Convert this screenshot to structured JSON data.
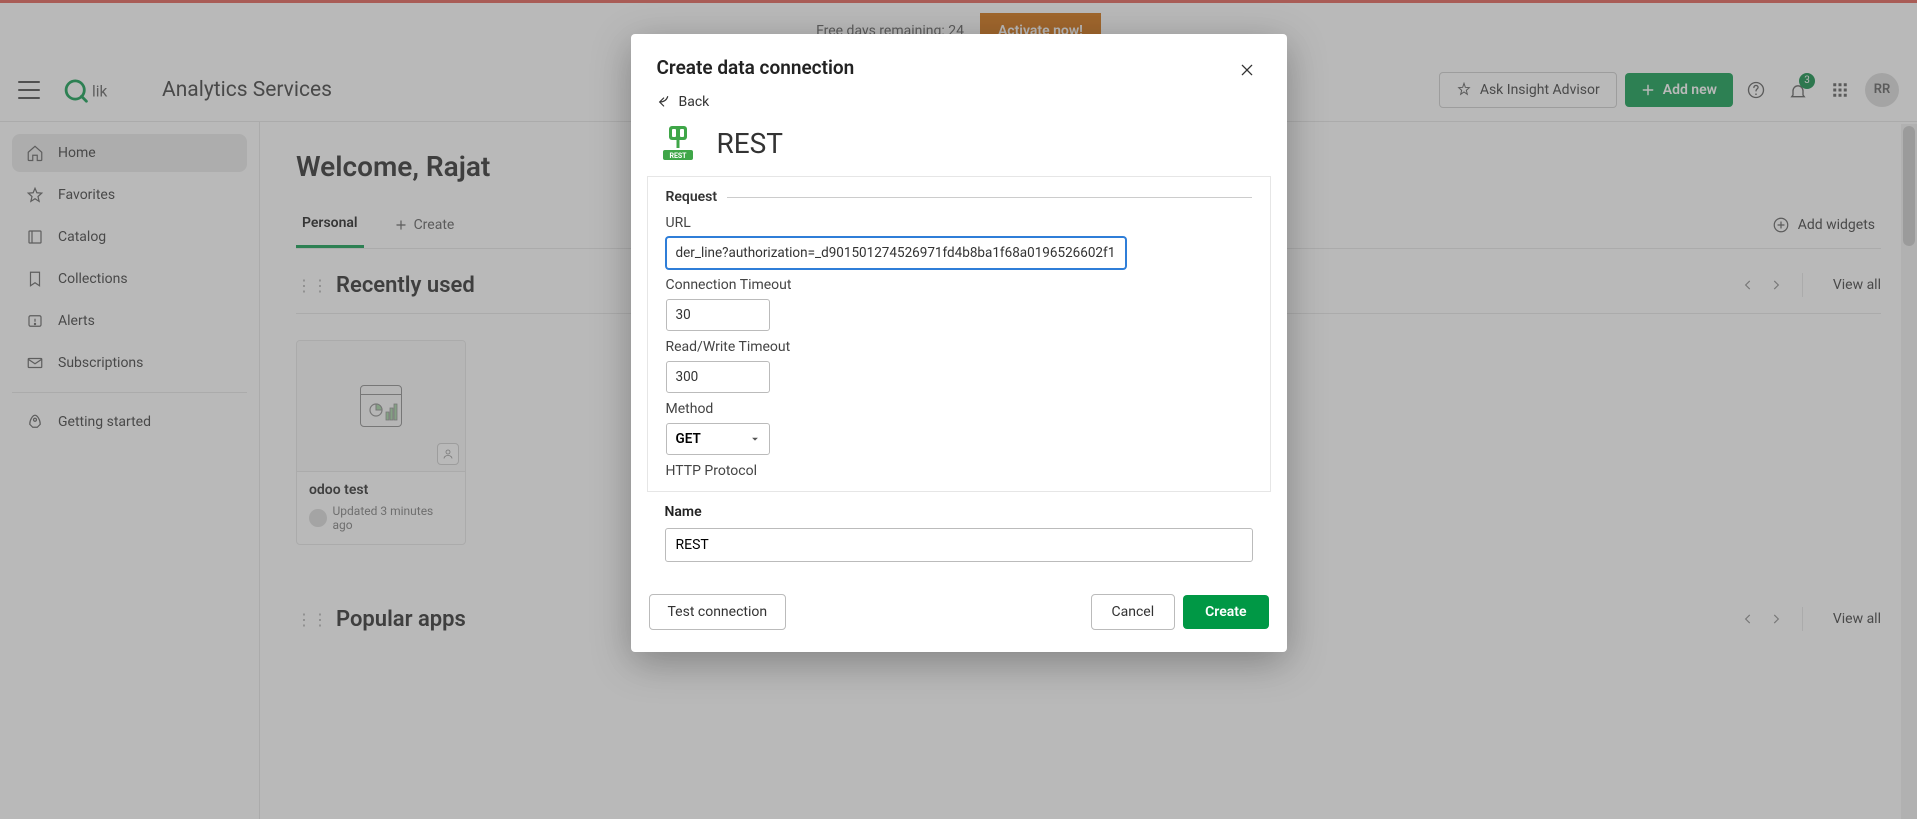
{
  "banner": {
    "text": "Free days remaining: 24",
    "cta": "Activate now!"
  },
  "header": {
    "app_title": "Analytics Services",
    "ask_label": "Ask Insight Advisor",
    "add_new_label": "Add new",
    "notification_count": "3",
    "avatar_initials": "RR"
  },
  "sidebar": {
    "items": [
      {
        "label": "Home",
        "icon": "home"
      },
      {
        "label": "Favorites",
        "icon": "star"
      },
      {
        "label": "Catalog",
        "icon": "catalog"
      },
      {
        "label": "Collections",
        "icon": "bookmark"
      },
      {
        "label": "Alerts",
        "icon": "alert"
      },
      {
        "label": "Subscriptions",
        "icon": "mail"
      },
      {
        "label": "Getting started",
        "icon": "rocket"
      }
    ]
  },
  "main": {
    "welcome": "Welcome, Rajat",
    "tab_personal": "Personal",
    "tab_create": "Create",
    "add_widgets": "Add widgets",
    "section_recent": "Recently used",
    "section_popular": "Popular apps",
    "view_all": "View all",
    "card": {
      "title": "odoo test",
      "meta": "Updated 3 minutes ago"
    }
  },
  "modal": {
    "title": "Create data connection",
    "back_label": "Back",
    "connector_name": "REST",
    "legend_request": "Request",
    "label_url": "URL",
    "url_value": "der_line?authorization=_d901501274526971fd4b8ba1f68a0196526602f1",
    "label_conn_timeout": "Connection Timeout",
    "conn_timeout_value": "30",
    "label_rw_timeout": "Read/Write Timeout",
    "rw_timeout_value": "300",
    "label_method": "Method",
    "method_value": "GET",
    "label_http_protocol": "HTTP Protocol",
    "label_name": "Name",
    "name_value": "REST",
    "btn_test": "Test connection",
    "btn_cancel": "Cancel",
    "btn_create": "Create"
  }
}
